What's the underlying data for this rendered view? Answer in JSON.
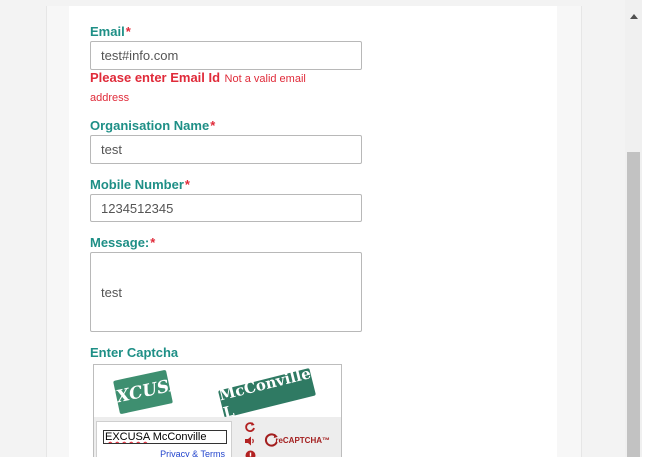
{
  "form": {
    "email": {
      "label": "Email",
      "required_mark": "*",
      "value": "test#info.com",
      "error_main": "Please enter Email Id",
      "error_detail": "Not a valid email address"
    },
    "organisation": {
      "label": "Organisation Name",
      "required_mark": "*",
      "value": "test"
    },
    "mobile": {
      "label": "Mobile Number",
      "required_mark": "*",
      "value": "1234512345"
    },
    "message": {
      "label": "Message:",
      "required_mark": "*",
      "value": "test"
    },
    "captcha": {
      "label": "Enter Captcha",
      "word1": "EXCUSA",
      "word2": "McConville L",
      "response_part1": "EXCUSA",
      "response_part2": " McConville",
      "privacy_text": "Privacy & Terms",
      "logo_text": "reCAPTCHA™"
    }
  },
  "colors": {
    "label": "#1e8f86",
    "required": "#e02b3a",
    "error": "#e02b3a",
    "captcha_logo": "#a31f1f"
  },
  "icons": [
    "refresh-icon",
    "audio-icon",
    "help-icon",
    "scroll-up-arrow-icon",
    "recaptcha-logo-icon"
  ]
}
